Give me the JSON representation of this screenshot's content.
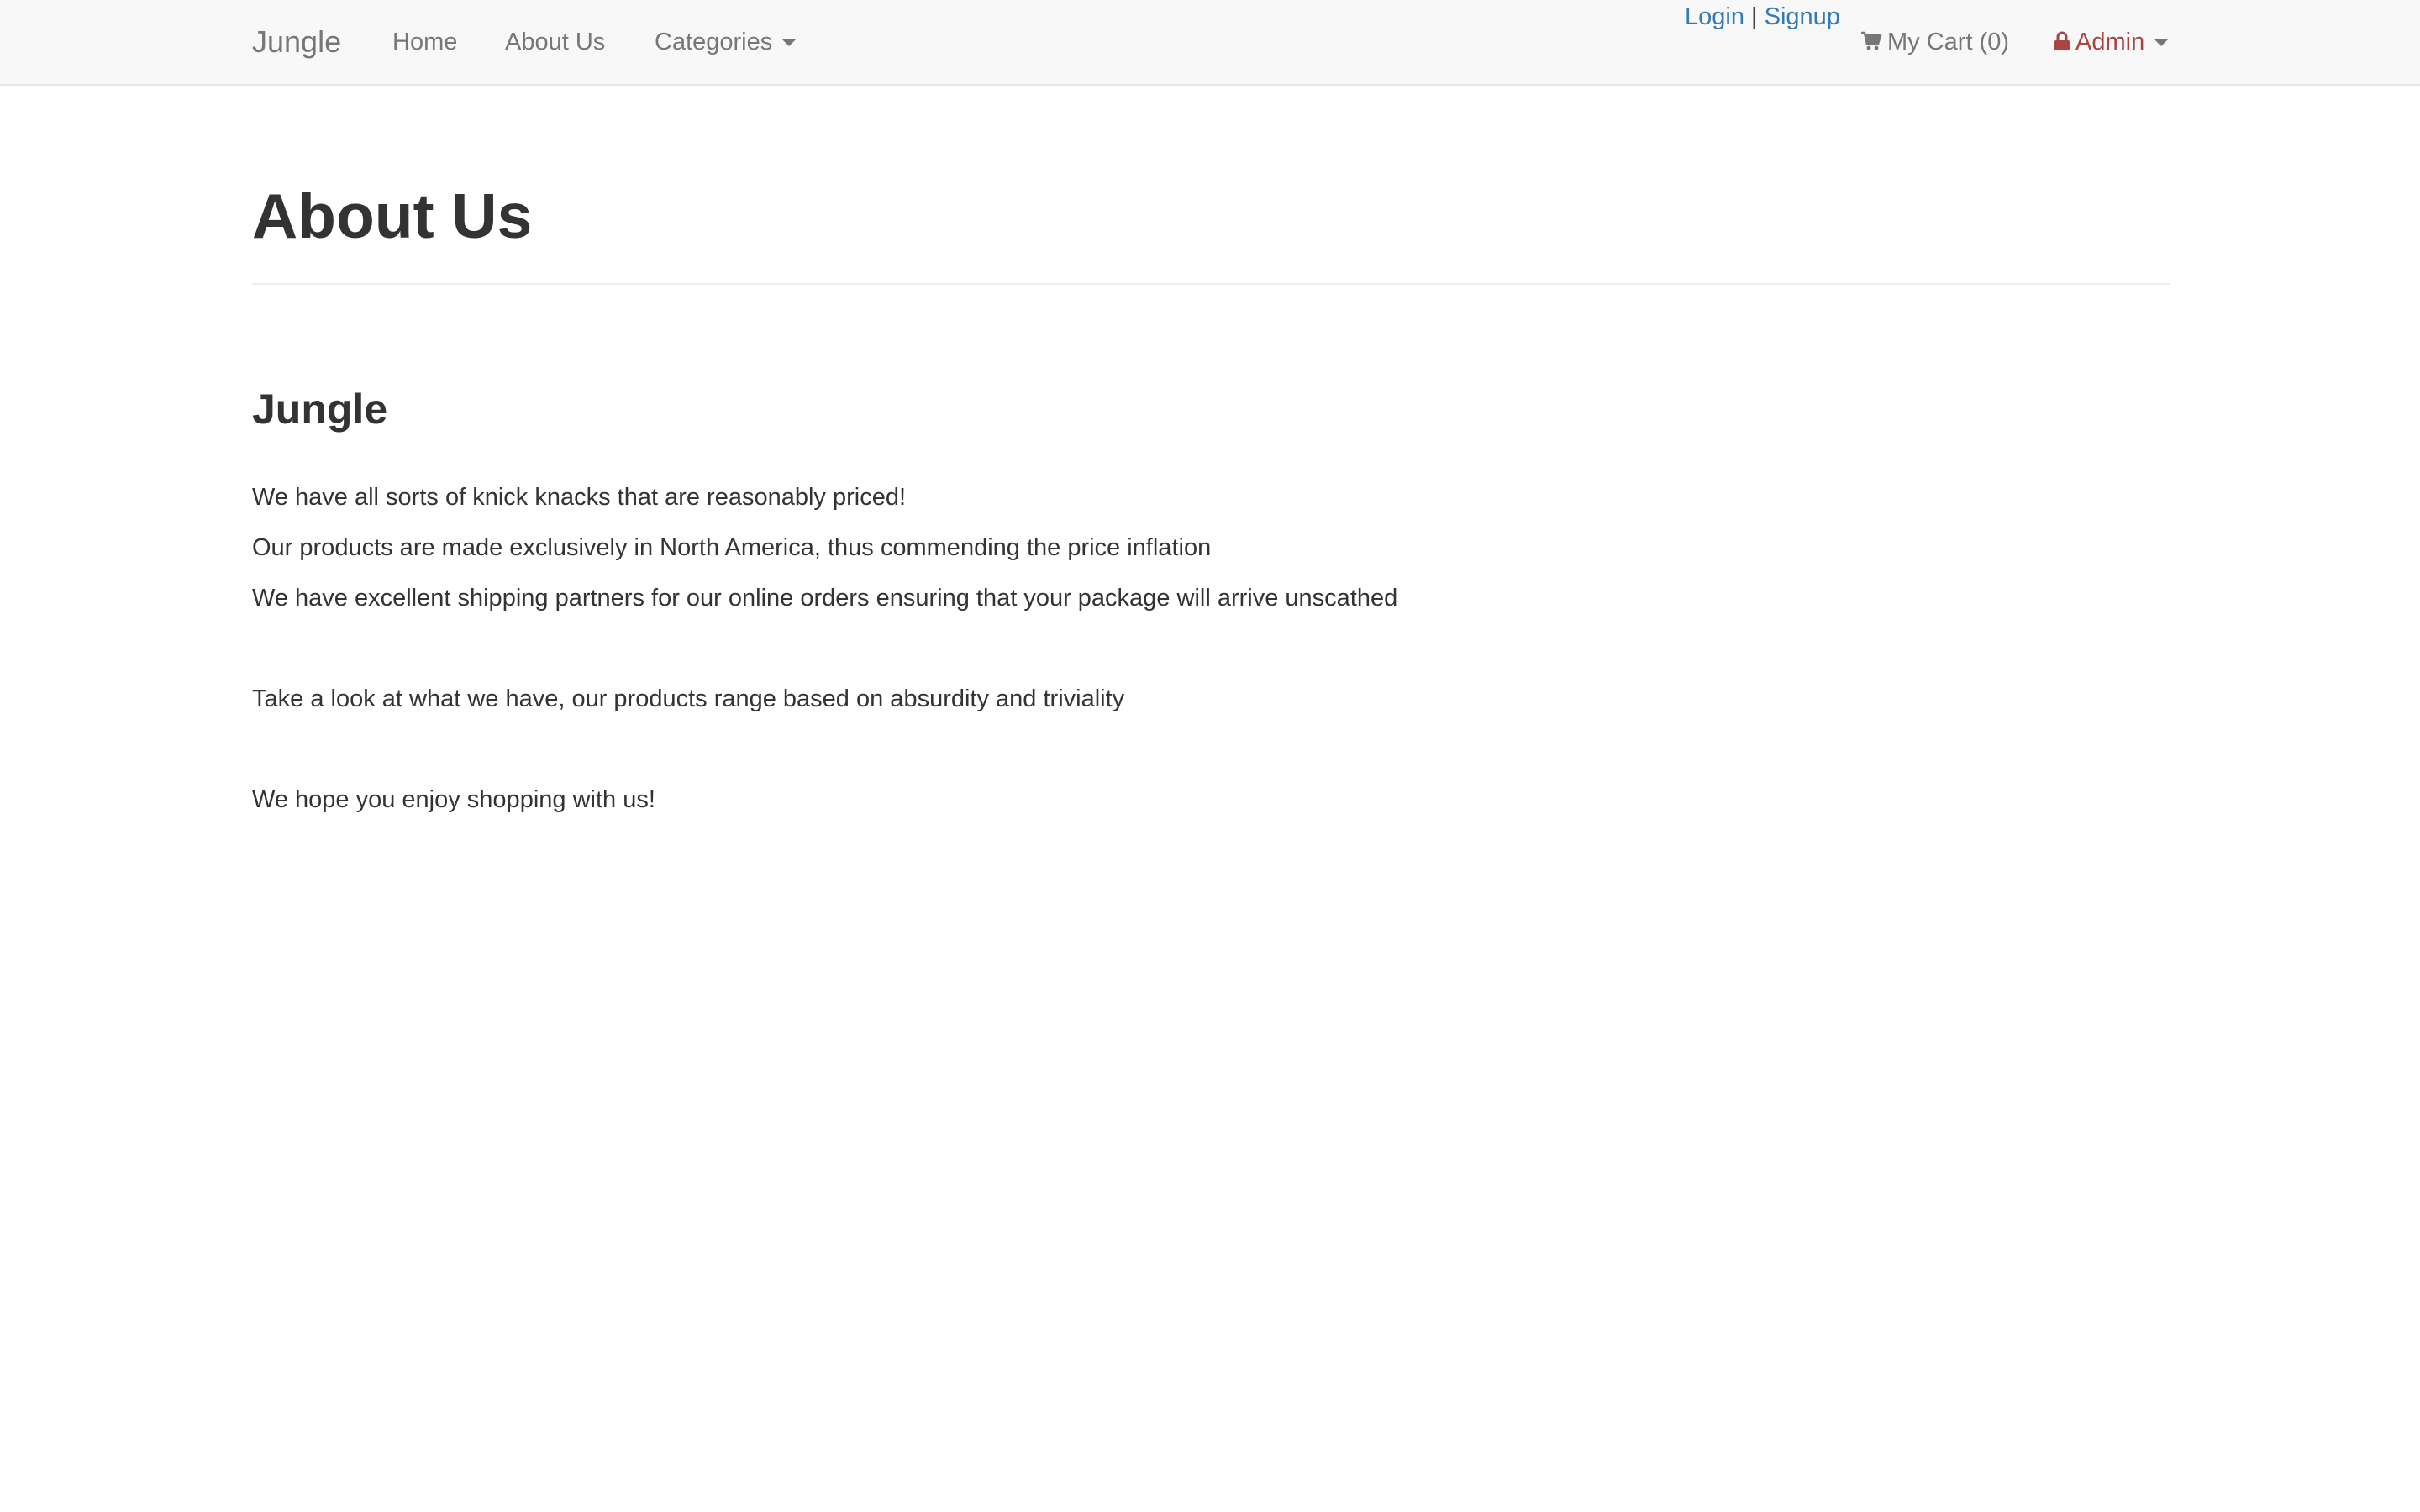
{
  "navbar": {
    "brand": "Jungle",
    "home": "Home",
    "about": "About Us",
    "categories": "Categories",
    "login": "Login",
    "separator": "|",
    "signup": "Signup",
    "cart": "My Cart (0)",
    "admin": "Admin"
  },
  "main": {
    "title": "About Us",
    "section_title": "Jungle",
    "paragraphs": [
      "We have all sorts of knick knacks that are reasonably priced!",
      "Our products are made exclusively in North America, thus commending the price inflation",
      "We have excellent shipping partners for our online orders ensuring that your package will arrive unscathed",
      "Take a look at what we have, our products range based on absurdity and triviality",
      "We hope you enjoy shopping with us!"
    ]
  },
  "colors": {
    "link": "#337ab7",
    "admin": "#a94442",
    "nav_text": "#777777",
    "navbar_bg": "#f8f8f8"
  },
  "icons": {
    "cart": "shopping-cart-icon",
    "admin": "lock-icon",
    "dropdown": "caret-down-icon"
  }
}
